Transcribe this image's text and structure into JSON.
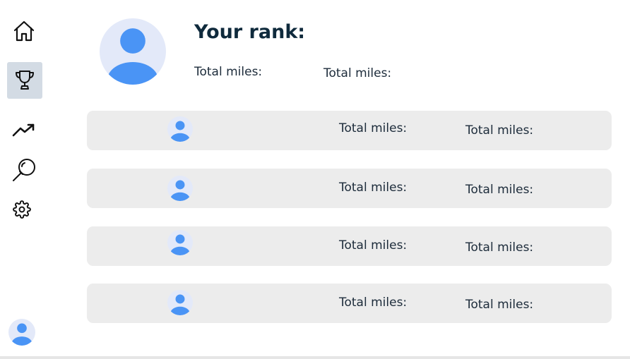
{
  "sidebar": {
    "items": [
      {
        "name": "home",
        "icon": "home-icon"
      },
      {
        "name": "leaderboard",
        "icon": "trophy-icon",
        "active": true
      },
      {
        "name": "trends",
        "icon": "trending-up-icon"
      },
      {
        "name": "search",
        "icon": "search-icon"
      },
      {
        "name": "settings",
        "icon": "gear-icon"
      }
    ],
    "profile_icon": "user-avatar-icon"
  },
  "my_rank": {
    "title": "Your rank:",
    "miles_label_1": "Total miles:",
    "miles_label_2": "Total miles:"
  },
  "leaderboard": [
    {
      "miles_label_1": "Total miles:",
      "miles_label_2": "Total miles:"
    },
    {
      "miles_label_1": "Total miles:",
      "miles_label_2": "Total miles:"
    },
    {
      "miles_label_1": "Total miles:",
      "miles_label_2": "Total miles:"
    },
    {
      "miles_label_1": "Total miles:",
      "miles_label_2": "Total miles:"
    }
  ],
  "colors": {
    "accent": "#4a94f5",
    "avatar_bg": "#e3e9f9",
    "row_bg": "#ececec",
    "active_nav_bg": "#d3dbe4",
    "title": "#0f2a3c"
  }
}
